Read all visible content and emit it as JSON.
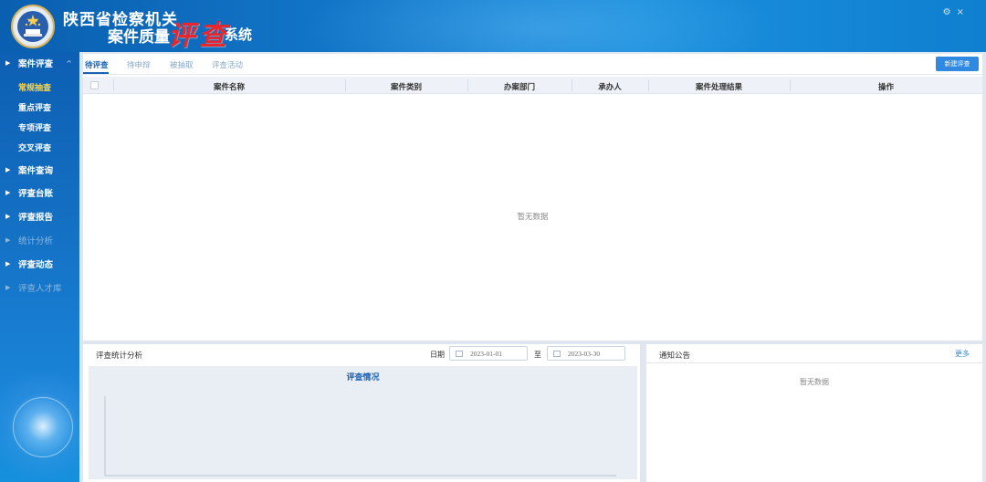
{
  "header": {
    "title_line1": "陕西省检察机关",
    "title_line2": "案件质量",
    "title_art": "评查",
    "title_line3": "系统",
    "icons": [
      "gear-icon",
      "close-icon"
    ]
  },
  "sidebar": {
    "items": [
      {
        "label": "案件评查",
        "expanded": true,
        "dim": false
      },
      {
        "label": "案件查询",
        "dim": false
      },
      {
        "label": "评查台账",
        "dim": false
      },
      {
        "label": "评查报告",
        "dim": false
      },
      {
        "label": "统计分析",
        "dim": true
      },
      {
        "label": "评查动态",
        "dim": false
      },
      {
        "label": "评查人才库",
        "dim": true
      }
    ],
    "subitems": [
      {
        "label": "常规抽查",
        "active": true
      },
      {
        "label": "重点评查",
        "active": false
      },
      {
        "label": "专项评查",
        "active": false
      },
      {
        "label": "交叉评查",
        "active": false
      }
    ]
  },
  "main": {
    "tabs": [
      {
        "label": "待评查",
        "active": true
      },
      {
        "label": "待申辩",
        "active": false
      },
      {
        "label": "被抽取",
        "active": false
      },
      {
        "label": "评查活动",
        "active": false
      }
    ],
    "new_button": "新建评查",
    "columns": [
      "案件名称",
      "案件类别",
      "办案部门",
      "承办人",
      "案件处理结果",
      "操作"
    ],
    "empty_text": "暂无数据"
  },
  "stats": {
    "title": "评查统计分析",
    "date_label": "日期",
    "start_date": "2023-01-01",
    "to_label": "至",
    "end_date": "2023-03-30",
    "chart_title": "评查情况"
  },
  "notice": {
    "title": "通知公告",
    "more": "更多",
    "empty_text": "暂无数据"
  },
  "colors": {
    "header_blue": "#1276c8",
    "active_tab": "#1a62b5",
    "active_subitem": "#ffd84a",
    "button_blue": "#2f89e0"
  }
}
